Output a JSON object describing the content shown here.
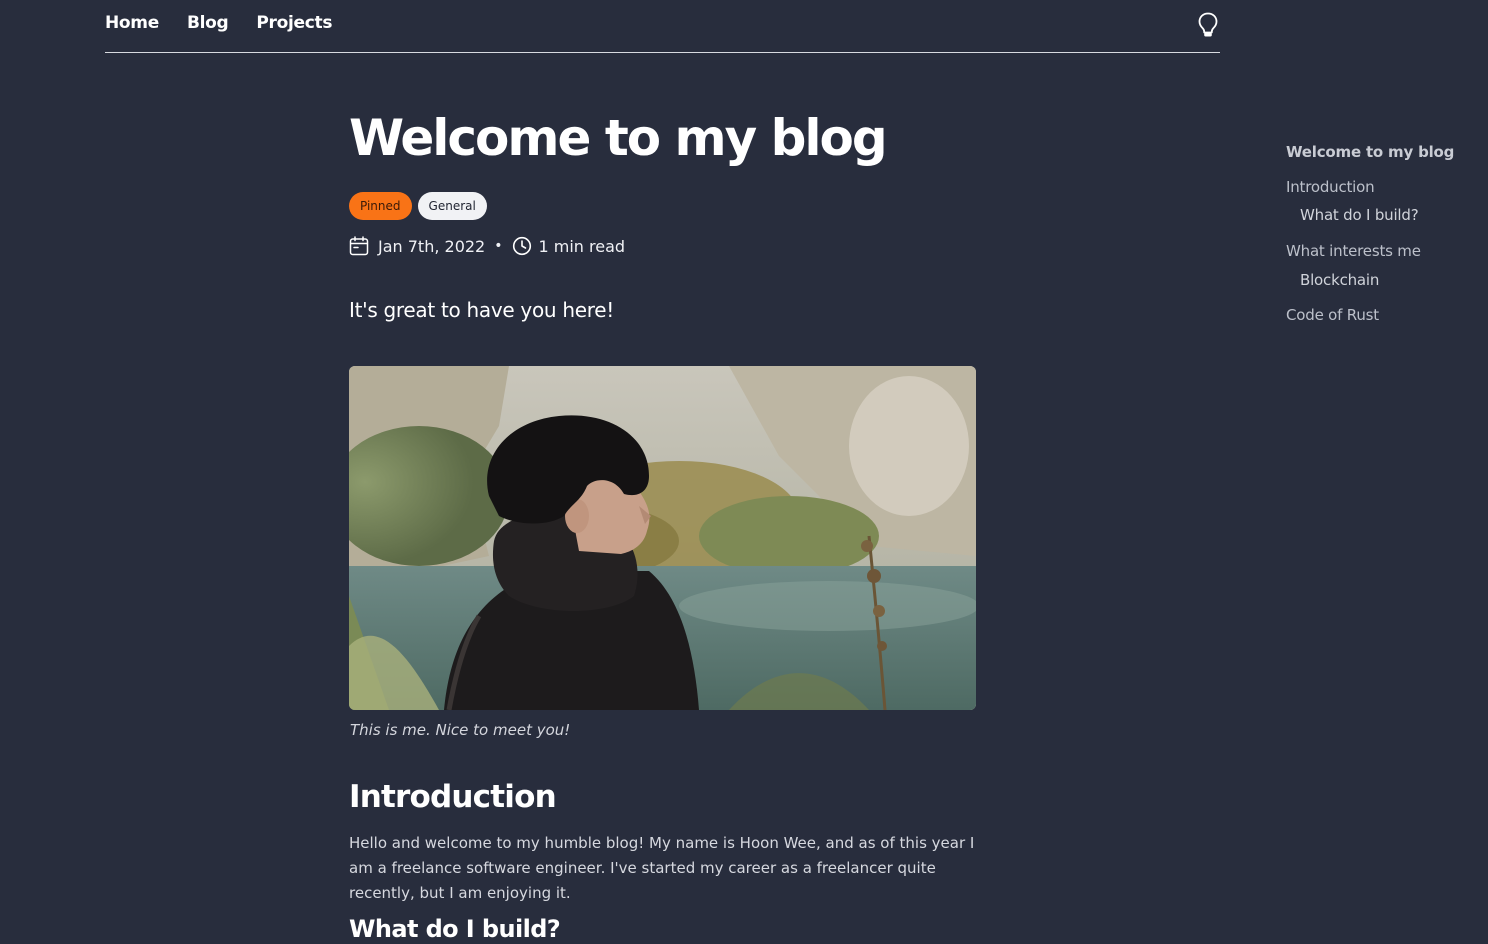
{
  "nav": {
    "links": [
      "Home",
      "Blog",
      "Projects"
    ],
    "theme_toggle_icon": "lightbulb-icon"
  },
  "post": {
    "title": "Welcome to my blog",
    "tags": [
      "Pinned",
      "General"
    ],
    "date": "Jan 7th, 2022",
    "separator": "•",
    "read_time": "1 min read",
    "date_icon": "calendar-icon",
    "read_time_icon": "clock-icon",
    "lead": "It's great to have you here!",
    "image_caption": "This is me. Nice to meet you!",
    "sections": {
      "introduction": {
        "heading": "Introduction",
        "body": "Hello and welcome to my humble blog! My name is Hoon Wee, and as of this year I am a freelance software engineer. I've started my career as a freelancer quite recently, but I am enjoying it."
      },
      "what_do_i_build": {
        "heading": "What do I build?"
      }
    }
  },
  "toc": {
    "items": [
      {
        "label": "Welcome to my blog",
        "level": 1,
        "active": true
      },
      {
        "label": "Introduction",
        "level": 1,
        "active": false
      },
      {
        "label": "What do I build?",
        "level": 2,
        "active": false
      },
      {
        "label": "What interests me",
        "level": 1,
        "active": false
      },
      {
        "label": "Blockchain",
        "level": 2,
        "active": false
      },
      {
        "label": "Code of Rust",
        "level": 1,
        "active": false
      }
    ]
  },
  "colors": {
    "background": "#282d3d",
    "pinned_tag": "#f97316",
    "general_tag": "#f1f2f5"
  }
}
